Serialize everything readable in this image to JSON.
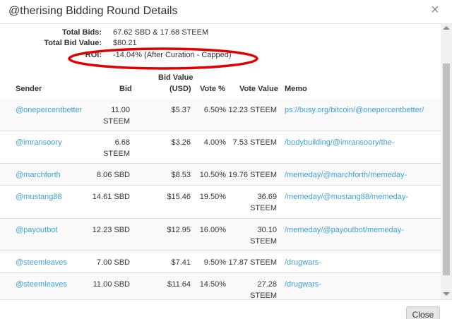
{
  "dialog": {
    "title": "@therising Bidding Round Details",
    "close_icon": "×",
    "close_button": "Close"
  },
  "summary": {
    "total_bids_label": "Total Bids:",
    "total_bids_value": "67.62 SBD & 17.68 STEEM",
    "total_bid_value_label": "Total Bid Value:",
    "total_bid_value_value": "$80.21",
    "roi_label": "ROI:",
    "roi_value": "-14.04% (After Curation - Capped)",
    "highlight_color": "#e00000"
  },
  "table": {
    "headers": {
      "sender": "Sender",
      "bid": "Bid",
      "bid_value_line1": "Bid Value",
      "bid_value_line2": "(USD)",
      "vote_pct": "Vote %",
      "vote_value": "Vote Value",
      "memo": "Memo"
    },
    "rows": [
      {
        "sender": "@onepercentbetter",
        "bid_1": "11.00",
        "bid_2": "STEEM",
        "bid_value": "$5.37",
        "vote_pct": "6.50%",
        "vote_value_1": "12.23 STEEM",
        "vote_value_2": "",
        "memo": "ps://busy.org/bitcoin/@onepercentbetter/"
      },
      {
        "sender": "@imransoory",
        "bid_1": "6.68",
        "bid_2": "STEEM",
        "bid_value": "$3.26",
        "vote_pct": "4.00%",
        "vote_value_1": "7.53 STEEM",
        "vote_value_2": "",
        "memo": "/bodybuilding/@imransoory/the-"
      },
      {
        "sender": "@marchforth",
        "bid_1": "8.06 SBD",
        "bid_2": "",
        "bid_value": "$8.53",
        "vote_pct": "10.50%",
        "vote_value_1": "19.76 STEEM",
        "vote_value_2": "",
        "memo": "/memeday/@marchforth/memeday-"
      },
      {
        "sender": "@mustang88",
        "bid_1": "14.61 SBD",
        "bid_2": "",
        "bid_value": "$15.46",
        "vote_pct": "19.50%",
        "vote_value_1": "36.69",
        "vote_value_2": "STEEM",
        "memo": "/memeday/@mustang88/memeday-"
      },
      {
        "sender": "@payoutbot",
        "bid_1": "12.23 SBD",
        "bid_2": "",
        "bid_value": "$12.95",
        "vote_pct": "16.00%",
        "vote_value_1": "30.10",
        "vote_value_2": "STEEM",
        "memo": "/memeday/@payoutbot/memeday-"
      },
      {
        "sender": "@steemleaves",
        "bid_1": "7.00 SBD",
        "bid_2": "",
        "bid_value": "$7.41",
        "vote_pct": "9.50%",
        "vote_value_1": "17.87 STEEM",
        "vote_value_2": "",
        "memo": "/drugwars-"
      },
      {
        "sender": "@steemleaves",
        "bid_1": "11.00 SBD",
        "bid_2": "",
        "bid_value": "$11.64",
        "vote_pct": "14.50%",
        "vote_value_1": "27.28",
        "vote_value_2": "STEEM",
        "memo": "/drugwars-"
      }
    ]
  },
  "colors": {
    "link": "#3aa3d6",
    "stripe": "#f9f9f9"
  }
}
